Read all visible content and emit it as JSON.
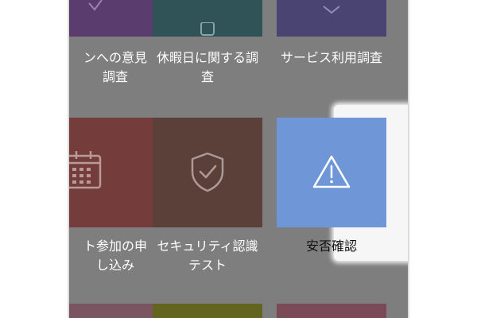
{
  "colors": {
    "overlay": "#7e7e7e",
    "purple": "#5a3d6e",
    "teal": "#2f5356",
    "indigo": "#4a4472",
    "brick": "#743c3a",
    "brown": "#5b3f39",
    "highlight_blue": "#6f97d8",
    "bottom_mauve": "#7a5460",
    "bottom_olive": "#63651e",
    "bottom_rose": "#7a4a57"
  },
  "tiles": [
    {
      "label": "ンへの意見\n調査",
      "icon": "check-icon"
    },
    {
      "label": "休暇日に関する調\n査",
      "icon": "calendar-check-icon"
    },
    {
      "label": "サービス利用調査",
      "icon": "chevron-icon"
    },
    {
      "label": "ト参加の申\nし込み",
      "icon": "calendar-icon"
    },
    {
      "label": "セキュリティ認識\nテスト",
      "icon": "shield-check-icon"
    },
    {
      "label": "安否確認",
      "icon": "warning-icon"
    }
  ]
}
